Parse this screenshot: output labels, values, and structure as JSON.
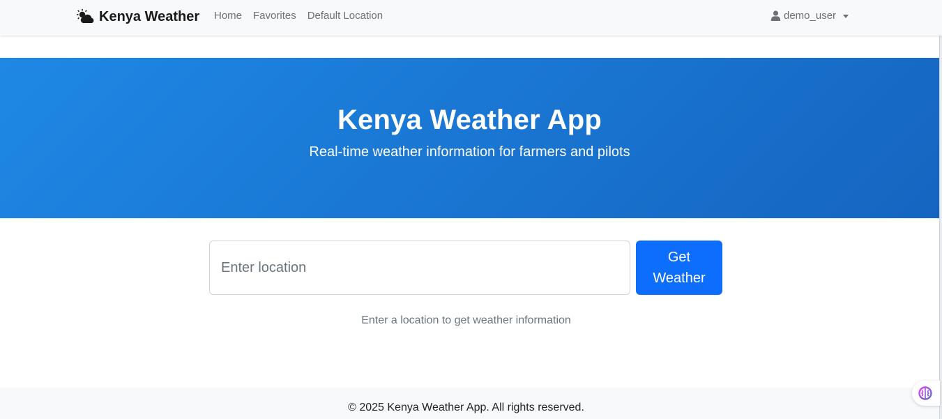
{
  "navbar": {
    "brand_label": "Kenya Weather",
    "brand_icon": "cloud-sun-icon",
    "links": [
      {
        "label": "Home"
      },
      {
        "label": "Favorites"
      },
      {
        "label": "Default Location"
      }
    ],
    "user": {
      "label": "demo_user",
      "icon": "user-icon"
    }
  },
  "hero": {
    "title": "Kenya Weather App",
    "subtitle": "Real-time weather information for farmers and pilots"
  },
  "search": {
    "placeholder": "Enter location",
    "value": "",
    "button_label": "Get Weather",
    "hint": "Enter a location to get weather information"
  },
  "footer": {
    "text": "© 2025 Kenya Weather App. All rights reserved."
  },
  "assistant": {
    "icon": "brain-icon"
  },
  "colors": {
    "hero_start": "#1e88e5",
    "hero_end": "#1565c0",
    "primary_button": "#0d6efd",
    "navbar_bg": "#f8f9fa"
  }
}
